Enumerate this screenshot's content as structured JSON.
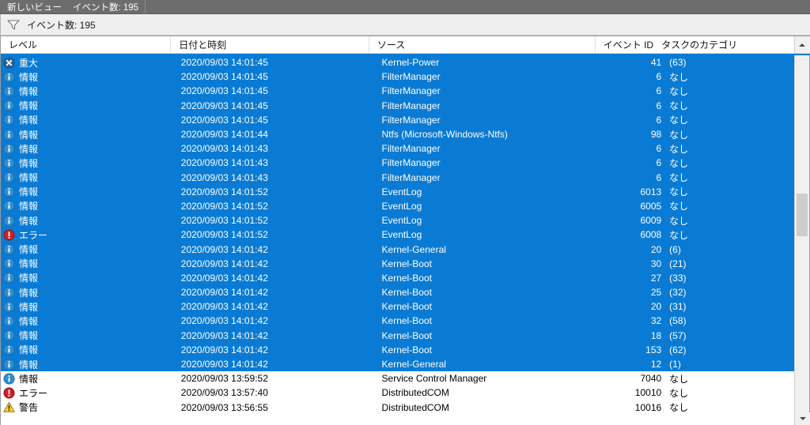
{
  "tab": {
    "title": "新しいビュー",
    "count_label": "イベント数: 195"
  },
  "filterbar": {
    "icon": "funnel-icon",
    "label": "イベント数: 195"
  },
  "columns": {
    "level": "レベル",
    "date": "日付と時刻",
    "source": "ソース",
    "event_id": "イベント ID",
    "task_category": "タスクのカテゴリ"
  },
  "scroll": {
    "up_icon": "caret-up-icon",
    "down_icon": "caret-down-icon"
  },
  "colors": {
    "selection": "#0a7bd4",
    "critical": "#2f6fb0",
    "information": "#2f8fd0",
    "error": "#cc2027",
    "warning": "#ffd23a",
    "tabstrip": "#6d6d6d"
  },
  "rows": [
    {
      "icon": "critical-icon",
      "level": "重大",
      "date": "2020/09/03 14:01:45",
      "source": "Kernel-Power",
      "event_id": "41",
      "task_category": "(63)",
      "selected": true
    },
    {
      "icon": "information-icon",
      "level": "情報",
      "date": "2020/09/03 14:01:45",
      "source": "FilterManager",
      "event_id": "6",
      "task_category": "なし",
      "selected": true
    },
    {
      "icon": "information-icon",
      "level": "情報",
      "date": "2020/09/03 14:01:45",
      "source": "FilterManager",
      "event_id": "6",
      "task_category": "なし",
      "selected": true
    },
    {
      "icon": "information-icon",
      "level": "情報",
      "date": "2020/09/03 14:01:45",
      "source": "FilterManager",
      "event_id": "6",
      "task_category": "なし",
      "selected": true
    },
    {
      "icon": "information-icon",
      "level": "情報",
      "date": "2020/09/03 14:01:45",
      "source": "FilterManager",
      "event_id": "6",
      "task_category": "なし",
      "selected": true
    },
    {
      "icon": "information-icon",
      "level": "情報",
      "date": "2020/09/03 14:01:44",
      "source": "Ntfs (Microsoft-Windows-Ntfs)",
      "event_id": "98",
      "task_category": "なし",
      "selected": true
    },
    {
      "icon": "information-icon",
      "level": "情報",
      "date": "2020/09/03 14:01:43",
      "source": "FilterManager",
      "event_id": "6",
      "task_category": "なし",
      "selected": true
    },
    {
      "icon": "information-icon",
      "level": "情報",
      "date": "2020/09/03 14:01:43",
      "source": "FilterManager",
      "event_id": "6",
      "task_category": "なし",
      "selected": true
    },
    {
      "icon": "information-icon",
      "level": "情報",
      "date": "2020/09/03 14:01:43",
      "source": "FilterManager",
      "event_id": "6",
      "task_category": "なし",
      "selected": true
    },
    {
      "icon": "information-icon",
      "level": "情報",
      "date": "2020/09/03 14:01:52",
      "source": "EventLog",
      "event_id": "6013",
      "task_category": "なし",
      "selected": true
    },
    {
      "icon": "information-icon",
      "level": "情報",
      "date": "2020/09/03 14:01:52",
      "source": "EventLog",
      "event_id": "6005",
      "task_category": "なし",
      "selected": true
    },
    {
      "icon": "information-icon",
      "level": "情報",
      "date": "2020/09/03 14:01:52",
      "source": "EventLog",
      "event_id": "6009",
      "task_category": "なし",
      "selected": true
    },
    {
      "icon": "error-icon",
      "level": "エラー",
      "date": "2020/09/03 14:01:52",
      "source": "EventLog",
      "event_id": "6008",
      "task_category": "なし",
      "selected": true
    },
    {
      "icon": "information-icon",
      "level": "情報",
      "date": "2020/09/03 14:01:42",
      "source": "Kernel-General",
      "event_id": "20",
      "task_category": "(6)",
      "selected": true
    },
    {
      "icon": "information-icon",
      "level": "情報",
      "date": "2020/09/03 14:01:42",
      "source": "Kernel-Boot",
      "event_id": "30",
      "task_category": "(21)",
      "selected": true
    },
    {
      "icon": "information-icon",
      "level": "情報",
      "date": "2020/09/03 14:01:42",
      "source": "Kernel-Boot",
      "event_id": "27",
      "task_category": "(33)",
      "selected": true
    },
    {
      "icon": "information-icon",
      "level": "情報",
      "date": "2020/09/03 14:01:42",
      "source": "Kernel-Boot",
      "event_id": "25",
      "task_category": "(32)",
      "selected": true
    },
    {
      "icon": "information-icon",
      "level": "情報",
      "date": "2020/09/03 14:01:42",
      "source": "Kernel-Boot",
      "event_id": "20",
      "task_category": "(31)",
      "selected": true
    },
    {
      "icon": "information-icon",
      "level": "情報",
      "date": "2020/09/03 14:01:42",
      "source": "Kernel-Boot",
      "event_id": "32",
      "task_category": "(58)",
      "selected": true
    },
    {
      "icon": "information-icon",
      "level": "情報",
      "date": "2020/09/03 14:01:42",
      "source": "Kernel-Boot",
      "event_id": "18",
      "task_category": "(57)",
      "selected": true
    },
    {
      "icon": "information-icon",
      "level": "情報",
      "date": "2020/09/03 14:01:42",
      "source": "Kernel-Boot",
      "event_id": "153",
      "task_category": "(62)",
      "selected": true
    },
    {
      "icon": "information-icon",
      "level": "情報",
      "date": "2020/09/03 14:01:42",
      "source": "Kernel-General",
      "event_id": "12",
      "task_category": "(1)",
      "selected": true
    },
    {
      "icon": "information-icon",
      "level": "情報",
      "date": "2020/09/03 13:59:52",
      "source": "Service Control Manager",
      "event_id": "7040",
      "task_category": "なし",
      "selected": false
    },
    {
      "icon": "error-icon",
      "level": "エラー",
      "date": "2020/09/03 13:57:40",
      "source": "DistributedCOM",
      "event_id": "10010",
      "task_category": "なし",
      "selected": false
    },
    {
      "icon": "warning-icon",
      "level": "警告",
      "date": "2020/09/03 13:56:55",
      "source": "DistributedCOM",
      "event_id": "10016",
      "task_category": "なし",
      "selected": false
    }
  ]
}
